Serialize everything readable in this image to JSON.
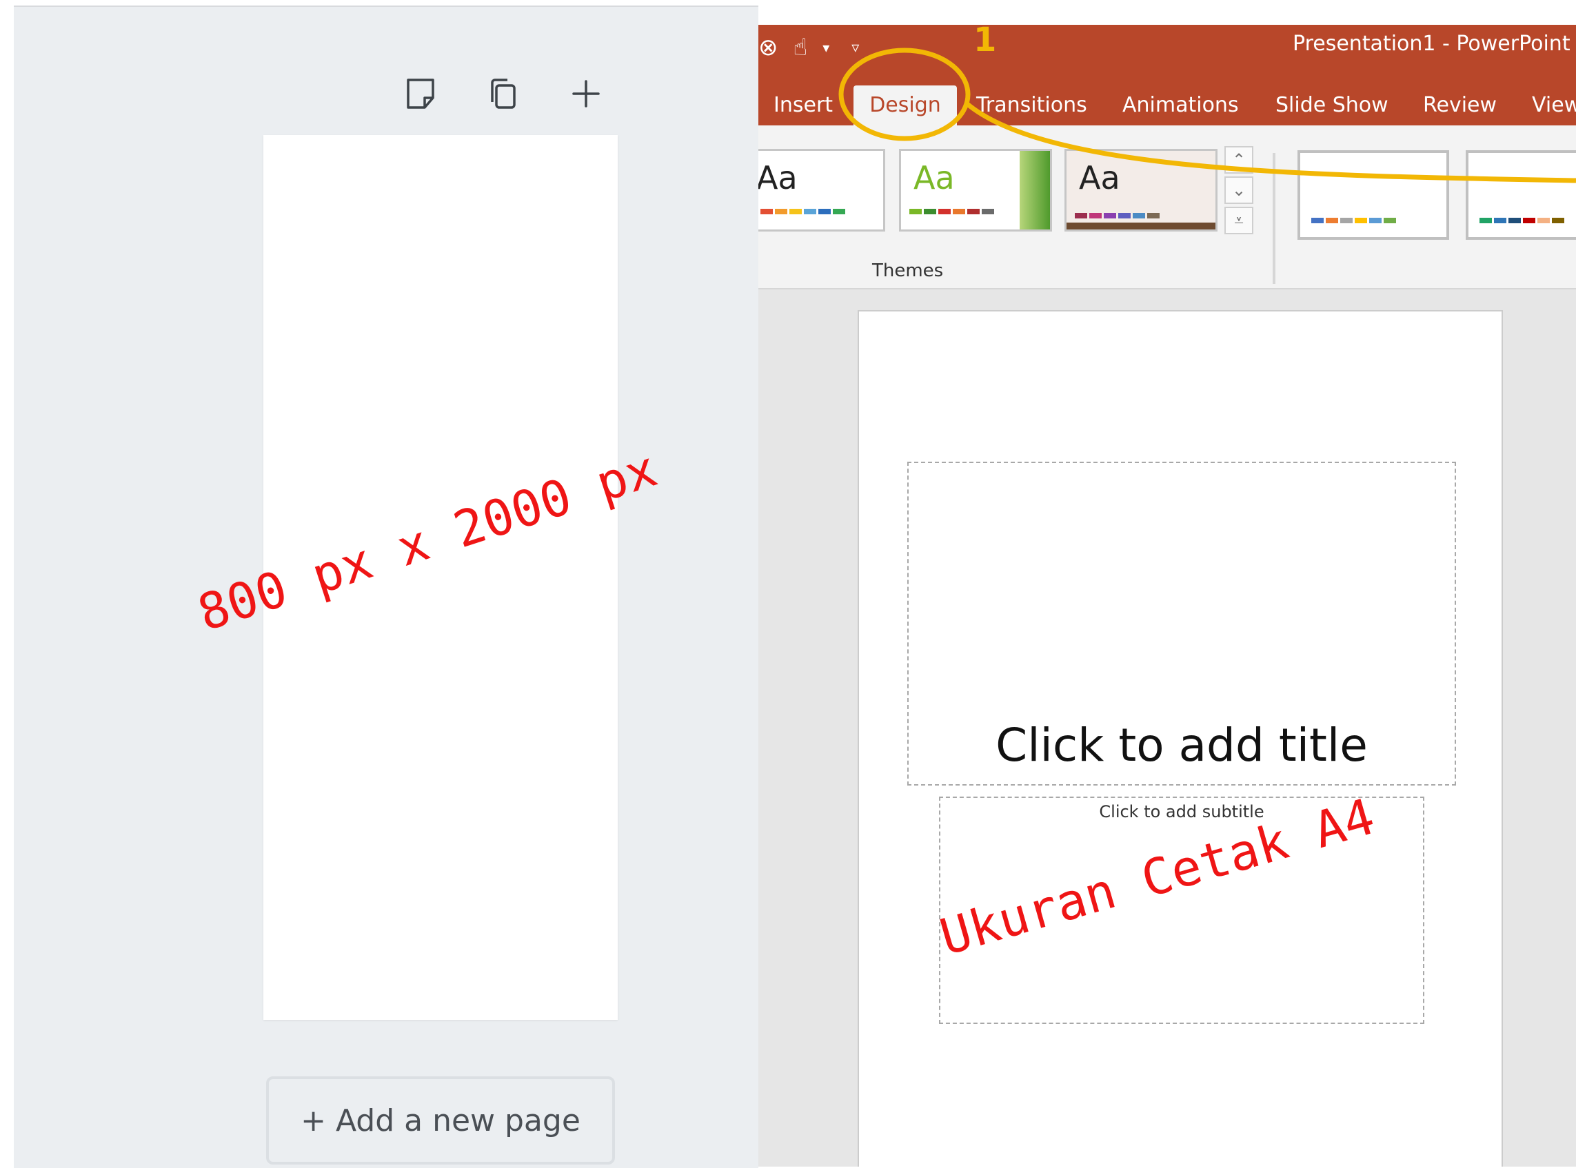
{
  "canva": {
    "toolbar": {
      "icons": [
        "note-icon",
        "duplicate-page-icon",
        "add-page-icon"
      ]
    },
    "add_page_label": "+ Add a new page",
    "annotation": "800 px x 2000 px"
  },
  "powerpoint": {
    "window_title": "Presentation1  -  PowerPoint",
    "qat_icons": [
      "autosave-icon",
      "touch-mode-icon",
      "customize-qat-icon"
    ],
    "tabs": [
      "Insert",
      "Design",
      "Transitions",
      "Animations",
      "Slide Show",
      "Review",
      "View"
    ],
    "active_tab": "Design",
    "themes": [
      {
        "label": "Aa",
        "colors": [
          "#e34f33",
          "#f29b2c",
          "#f5c31a",
          "#5aa4d8",
          "#2c6ebd",
          "#35a853"
        ]
      },
      {
        "label": "Aa",
        "colors": [
          "#7ab827",
          "#3c8d2f",
          "#d3312c",
          "#e9782c",
          "#b02e2e",
          "#6b6b6b"
        ]
      },
      {
        "label": "Aa",
        "colors": [
          "#9c2e4f",
          "#c0367a",
          "#8a3fb0",
          "#5e5ec0",
          "#4b8bc4",
          "#7c6a55"
        ]
      }
    ],
    "themes_group_label": "Themes",
    "variants": [
      {
        "colors": [
          "#4472c4",
          "#ed7d31",
          "#a5a5a5",
          "#ffc000",
          "#5b9bd5",
          "#70ad47"
        ]
      },
      {
        "colors": [
          "#21a366",
          "#2e75b6",
          "#1f4e79",
          "#c00000",
          "#f4b183",
          "#7f6000"
        ]
      }
    ],
    "slide": {
      "title_placeholder": "Click to add title",
      "subtitle_placeholder": "Click to add subtitle"
    },
    "annotation": "Ukuran Cetak A4",
    "step_number": "1",
    "highlight_color": "#f2b705"
  }
}
